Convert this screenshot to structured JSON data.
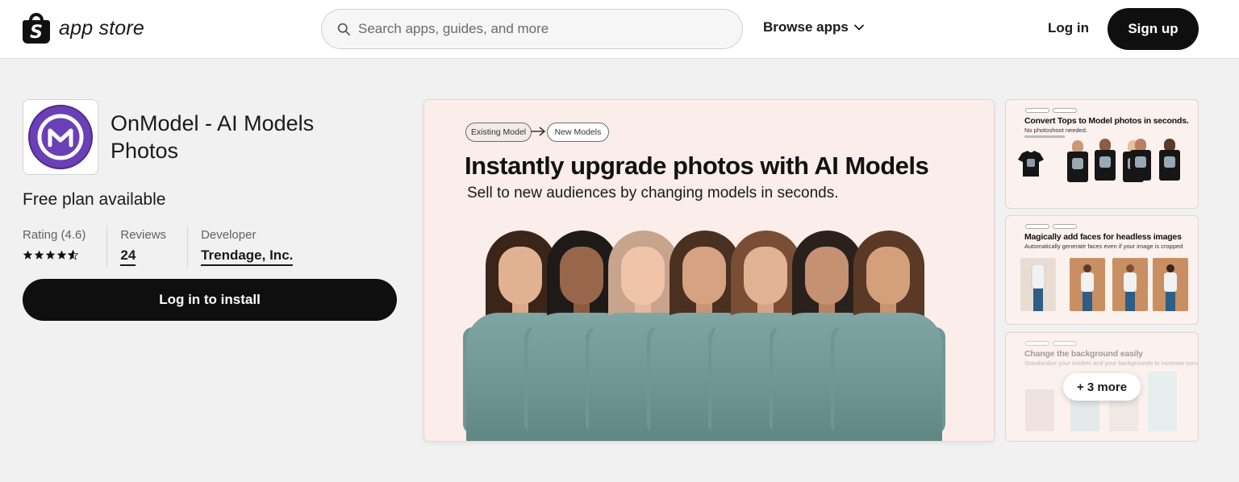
{
  "header": {
    "logo_text": "app store",
    "search_placeholder": "Search apps, guides, and more",
    "browse_label": "Browse apps",
    "login_label": "Log in",
    "signup_label": "Sign up"
  },
  "app": {
    "title": "OnModel - AI Models Photos",
    "pricing": "Free plan available",
    "rating_label": "Rating (4.6)",
    "rating_value": 4.6,
    "reviews_label": "Reviews",
    "reviews_count": "24",
    "developer_label": "Developer",
    "developer_name": "Trendage, Inc.",
    "install_label": "Log in to install",
    "icon_color": "#6b3fb5"
  },
  "hero": {
    "pill_from": "Existing Model",
    "pill_to": "New Models",
    "headline": "Instantly upgrade photos with AI Models",
    "subline": "Sell to new audiences by changing models in seconds."
  },
  "thumbnails": [
    {
      "title": "Convert Tops to Model photos in seconds.",
      "subtitle": "No photoshoot needed."
    },
    {
      "title": "Magically add faces for headless images",
      "subtitle": "Automatically generate faces even if your image is cropped"
    },
    {
      "title": "Change the background easily",
      "subtitle": "Standardize your models and your backgrounds to increase conversions"
    }
  ],
  "more_label": "+ 3 more",
  "colors": {
    "primary_button": "#0f0f0f",
    "hero_background": "#fbeeea",
    "sweater": "#7fa6a3"
  }
}
